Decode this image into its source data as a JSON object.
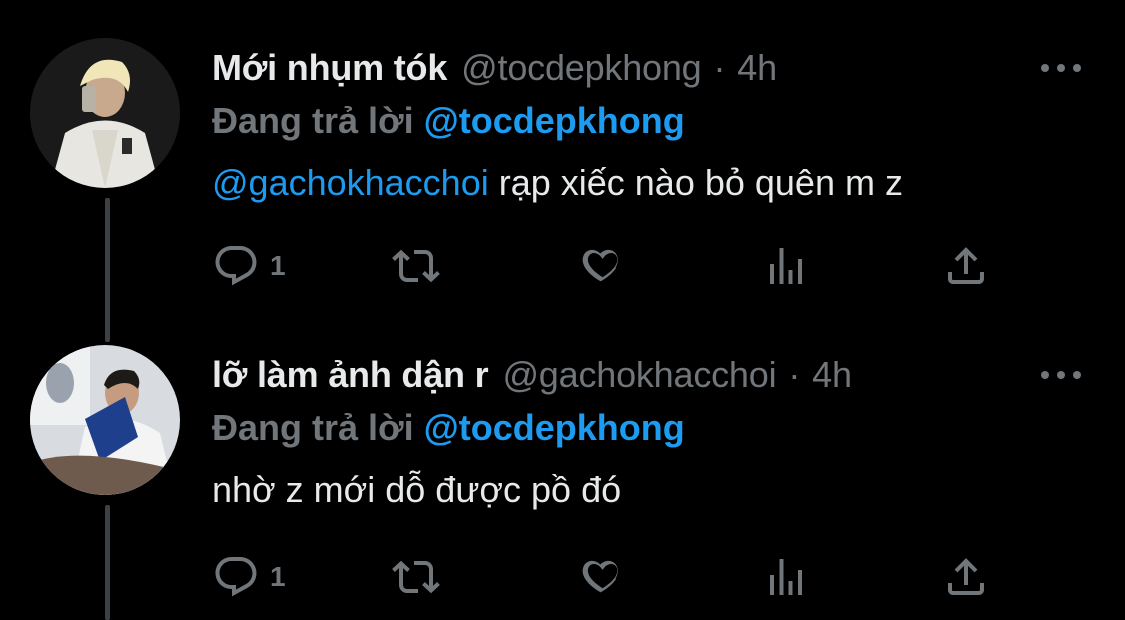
{
  "colors": {
    "background": "#000000",
    "name": "#e7e9ea",
    "muted": "#71767b",
    "accent": "#1d9bf0",
    "thread_line": "#3e4144"
  },
  "tweets": [
    {
      "display_name": "Mới nhụm tók",
      "handle": "@tocdepkhong",
      "separator": "·",
      "time": "4h",
      "replying_label": "Đang trả lời",
      "replying_to": "@tocdepkhong",
      "text_mention": "@gachokhacchoi",
      "text": " rạp xiếc nào bỏ quên m z",
      "reply_count": "1",
      "icons": [
        "reply-icon",
        "retweet-icon",
        "like-icon",
        "analytics-icon",
        "share-icon",
        "more-icon"
      ]
    },
    {
      "display_name": "lỡ làm ảnh dận r",
      "handle": "@gachokhacchoi",
      "separator": "·",
      "time": "4h",
      "replying_label": "Đang trả lời",
      "replying_to": "@tocdepkhong",
      "text_mention": "",
      "text": "nhờ z mới dỗ được pồ đó",
      "reply_count": "1",
      "icons": [
        "reply-icon",
        "retweet-icon",
        "like-icon",
        "analytics-icon",
        "share-icon",
        "more-icon"
      ]
    }
  ]
}
